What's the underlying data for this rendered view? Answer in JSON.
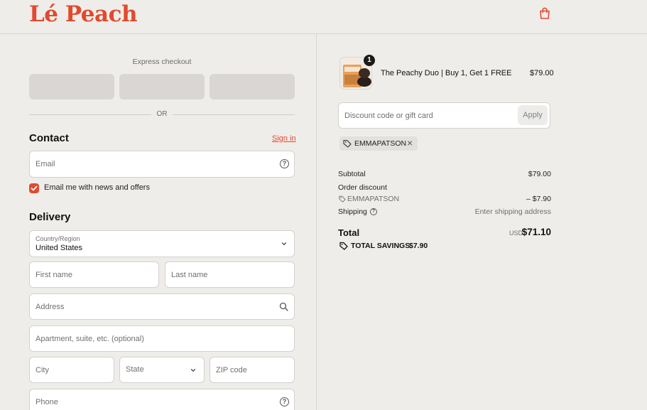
{
  "header": {
    "brand": "Lé Peach",
    "cart_icon": "shopping-bag-icon",
    "accent": "#e04a2f"
  },
  "checkout": {
    "express_title": "Express checkout",
    "or_text": "OR",
    "contact": {
      "title": "Contact",
      "sign_in": "Sign in",
      "email_placeholder": "Email",
      "marketing_opt_in": "Email me with news and offers",
      "marketing_checked": true
    },
    "delivery": {
      "title": "Delivery",
      "country_label": "Country/Region",
      "country_value": "United States",
      "first_name": "First name",
      "last_name": "Last name",
      "address": "Address",
      "apartment": "Apartment, suite, etc. (optional)",
      "city": "City",
      "state": "State",
      "zip": "ZIP code",
      "phone": "Phone"
    }
  },
  "summary": {
    "item": {
      "name": "The Peachy Duo | Buy 1, Get 1 FREE",
      "price": "$79.00",
      "quantity": "1"
    },
    "discount_placeholder": "Discount code or gift card",
    "apply_label": "Apply",
    "applied_code": "EMMAPATSON",
    "subtotal_label": "Subtotal",
    "subtotal_value": "$79.00",
    "order_discount_label": "Order discount",
    "discount_code": "EMMAPATSON",
    "discount_value": "– $7.90",
    "shipping_label": "Shipping",
    "shipping_value": "Enter shipping address",
    "total_label": "Total",
    "total_currency": "USD",
    "total_value": "$71.10",
    "savings_label": "TOTAL SAVINGS",
    "savings_value": "$7.90"
  }
}
